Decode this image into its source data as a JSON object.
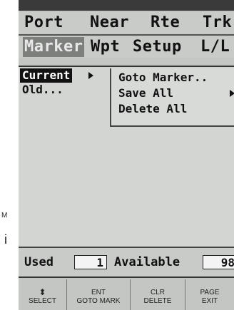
{
  "side_labels": {
    "m": "M",
    "i": "i"
  },
  "menu": {
    "row1": [
      "Port",
      "Near",
      "Rte",
      "Trk"
    ],
    "row2": [
      "Marker",
      "Wpt",
      "Setup",
      "L/L"
    ],
    "selected": "Marker"
  },
  "list": {
    "items": [
      "Current",
      "Old..."
    ],
    "selected": "Current"
  },
  "submenu": {
    "items": [
      "Goto Marker..",
      "Save All",
      "Delete All"
    ]
  },
  "status": {
    "used_label": "Used",
    "used_value": "1",
    "available_label": "Available",
    "available_value": "98"
  },
  "softkeys": [
    {
      "top": "⬍",
      "bottom": "SELECT"
    },
    {
      "top": "ENT",
      "bottom": "GOTO MARK"
    },
    {
      "top": "CLR",
      "bottom": "DELETE"
    },
    {
      "top": "PAGE",
      "bottom": "EXIT"
    }
  ]
}
